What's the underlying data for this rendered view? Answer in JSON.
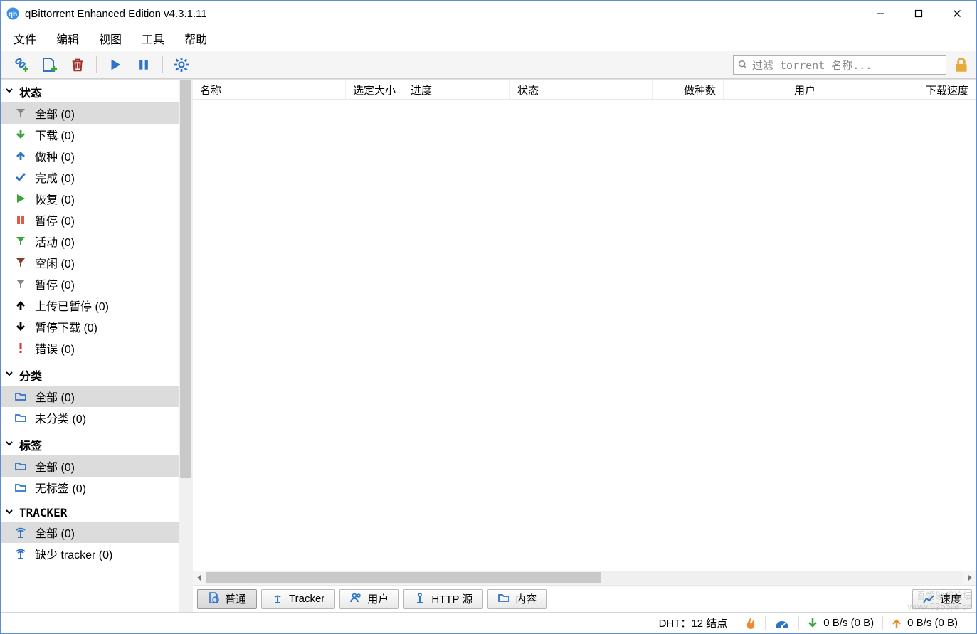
{
  "window": {
    "title": "qBittorrent Enhanced Edition v4.3.1.11"
  },
  "menu": [
    "文件",
    "编辑",
    "视图",
    "工具",
    "帮助"
  ],
  "search": {
    "placeholder": "过滤 torrent 名称..."
  },
  "sidebar": {
    "sections": [
      {
        "title": "状态",
        "items": [
          {
            "label": "全部 (0)",
            "icon": "funnel-gray",
            "selected": true
          },
          {
            "label": "下载 (0)",
            "icon": "arrow-down-green"
          },
          {
            "label": "做种 (0)",
            "icon": "arrow-up-blue"
          },
          {
            "label": "完成 (0)",
            "icon": "check-blue"
          },
          {
            "label": "恢复 (0)",
            "icon": "play-green"
          },
          {
            "label": "暂停 (0)",
            "icon": "pause-red"
          },
          {
            "label": "活动 (0)",
            "icon": "funnel-green"
          },
          {
            "label": "空闲 (0)",
            "icon": "funnel-maroon"
          },
          {
            "label": "暂停 (0)",
            "icon": "funnel-gray"
          },
          {
            "label": "上传已暂停 (0)",
            "icon": "arrow-up-black"
          },
          {
            "label": "暂停下载 (0)",
            "icon": "arrow-down-black"
          },
          {
            "label": "错误 (0)",
            "icon": "bang-red"
          }
        ]
      },
      {
        "title": "分类",
        "items": [
          {
            "label": "全部 (0)",
            "icon": "folder-blue",
            "selected": true
          },
          {
            "label": "未分类 (0)",
            "icon": "folder-blue"
          }
        ]
      },
      {
        "title": "标签",
        "items": [
          {
            "label": "全部 (0)",
            "icon": "folder-blue",
            "selected": true
          },
          {
            "label": "无标签 (0)",
            "icon": "folder-blue"
          }
        ]
      },
      {
        "title": "TRACKER",
        "items": [
          {
            "label": "全部 (0)",
            "icon": "tracker-blue",
            "selected": true
          },
          {
            "label": "缺少 tracker (0)",
            "icon": "tracker-blue"
          }
        ]
      }
    ]
  },
  "columns": [
    "名称",
    "选定大小",
    "进度",
    "状态",
    "做种数",
    "用户",
    "下载速度"
  ],
  "columns_align": [
    "left",
    "right",
    "left",
    "left",
    "right",
    "right",
    "right"
  ],
  "tabs": [
    {
      "label": "普通",
      "icon": "doc-icon",
      "active": true
    },
    {
      "label": "Tracker",
      "icon": "tracker-icon"
    },
    {
      "label": "用户",
      "icon": "peers-icon"
    },
    {
      "label": "HTTP 源",
      "icon": "http-icon"
    },
    {
      "label": "内容",
      "icon": "folder-icon"
    }
  ],
  "speed_tab": {
    "label": "速度"
  },
  "statusbar": {
    "dht": "DHT：12 结点",
    "down": "0 B/s (0 B)",
    "up": "0 B/s (0 B)"
  },
  "watermark": {
    "line1": "吾爱破解论坛",
    "line2": "www.52pojie.cn"
  }
}
